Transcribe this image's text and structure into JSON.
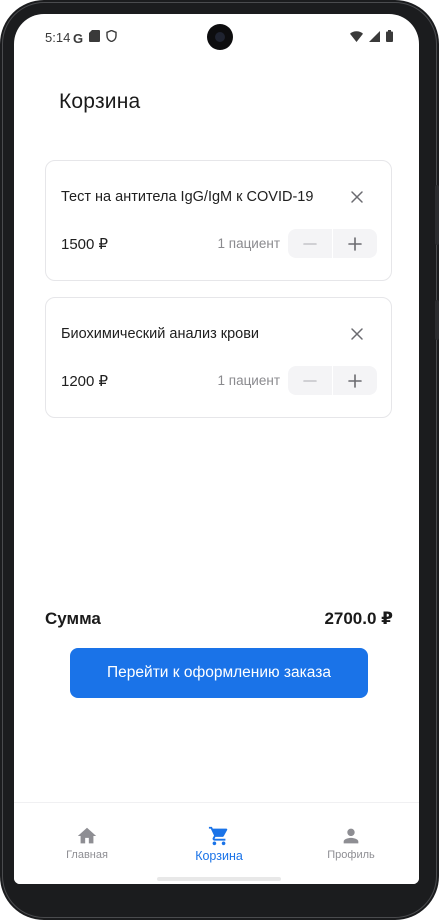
{
  "status_bar": {
    "time": "5:14",
    "left_icons": [
      "google-icon",
      "sd-card-icon",
      "shield-icon"
    ],
    "right_icons": [
      "wifi-icon",
      "signal-icon",
      "battery-icon"
    ]
  },
  "page": {
    "title": "Корзина"
  },
  "cart": {
    "items": [
      {
        "title": "Тест на антитела IgG/IgM к COVID-19",
        "price": "1500 ₽",
        "quantity": "1 пациент"
      },
      {
        "title": "Биохимический анализ крови",
        "price": "1200 ₽",
        "quantity": "1 пациент"
      }
    ]
  },
  "summary": {
    "label": "Сумма",
    "value": "2700.0 ₽"
  },
  "checkout": {
    "label": "Перейти к оформлению заказа"
  },
  "bottom_nav": {
    "items": [
      {
        "label": "Главная",
        "icon": "home-icon",
        "active": false
      },
      {
        "label": "Корзина",
        "icon": "cart-icon",
        "active": true
      },
      {
        "label": "Профиль",
        "icon": "profile-icon",
        "active": false
      }
    ]
  },
  "colors": {
    "accent": "#1a73e8",
    "text": "#1a1a1a",
    "muted": "#8e8e93",
    "card_border": "#e6e6e9",
    "stepper_bg": "#f4f4f6"
  }
}
